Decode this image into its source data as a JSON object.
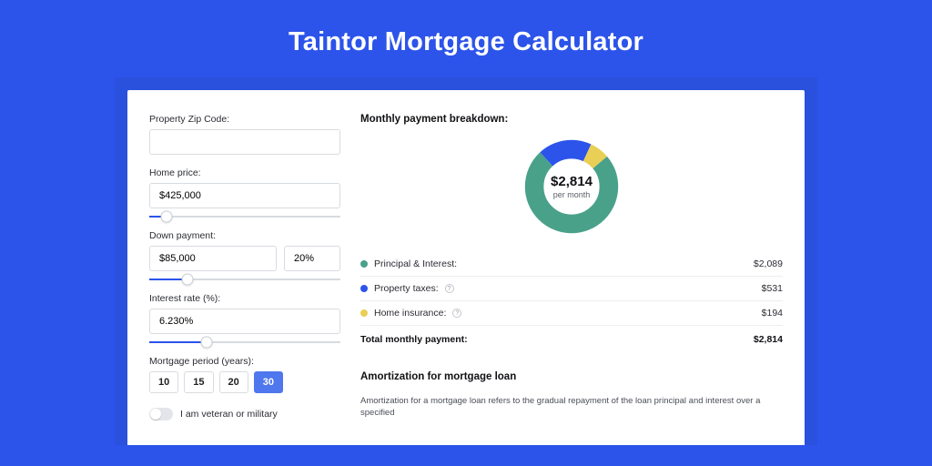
{
  "hero": {
    "title": "Taintor Mortgage Calculator"
  },
  "form": {
    "zip": {
      "label": "Property Zip Code:",
      "value": ""
    },
    "price": {
      "label": "Home price:",
      "value": "$425,000",
      "slider_pct": 9
    },
    "down": {
      "label": "Down payment:",
      "value": "$85,000",
      "pct_value": "20%",
      "slider_pct": 20
    },
    "rate": {
      "label": "Interest rate (%):",
      "value": "6.230%",
      "slider_pct": 30
    },
    "period": {
      "label": "Mortgage period (years):",
      "options": [
        "10",
        "15",
        "20",
        "30"
      ],
      "active": "30"
    },
    "veteran_label": "I am veteran or military"
  },
  "breakdown": {
    "title": "Monthly payment breakdown:",
    "center_amount": "$2,814",
    "center_sub": "per month",
    "items": [
      {
        "color": "green",
        "label": "Principal & Interest:",
        "value": "$2,089",
        "info": false
      },
      {
        "color": "blue",
        "label": "Property taxes:",
        "value": "$531",
        "info": true
      },
      {
        "color": "yellow",
        "label": "Home insurance:",
        "value": "$194",
        "info": true
      }
    ],
    "total_label": "Total monthly payment:",
    "total_value": "$2,814"
  },
  "amort": {
    "title": "Amortization for mortgage loan",
    "body": "Amortization for a mortgage loan refers to the gradual repayment of the loan principal and interest over a specified"
  },
  "chart_data": {
    "type": "pie",
    "title": "Monthly payment breakdown",
    "series": [
      {
        "name": "Principal & Interest",
        "value": 2089,
        "color": "#4aa18a"
      },
      {
        "name": "Property taxes",
        "value": 531,
        "color": "#2c54ea"
      },
      {
        "name": "Home insurance",
        "value": 194,
        "color": "#e9cf55"
      }
    ],
    "total": 2814,
    "unit": "$ per month"
  }
}
